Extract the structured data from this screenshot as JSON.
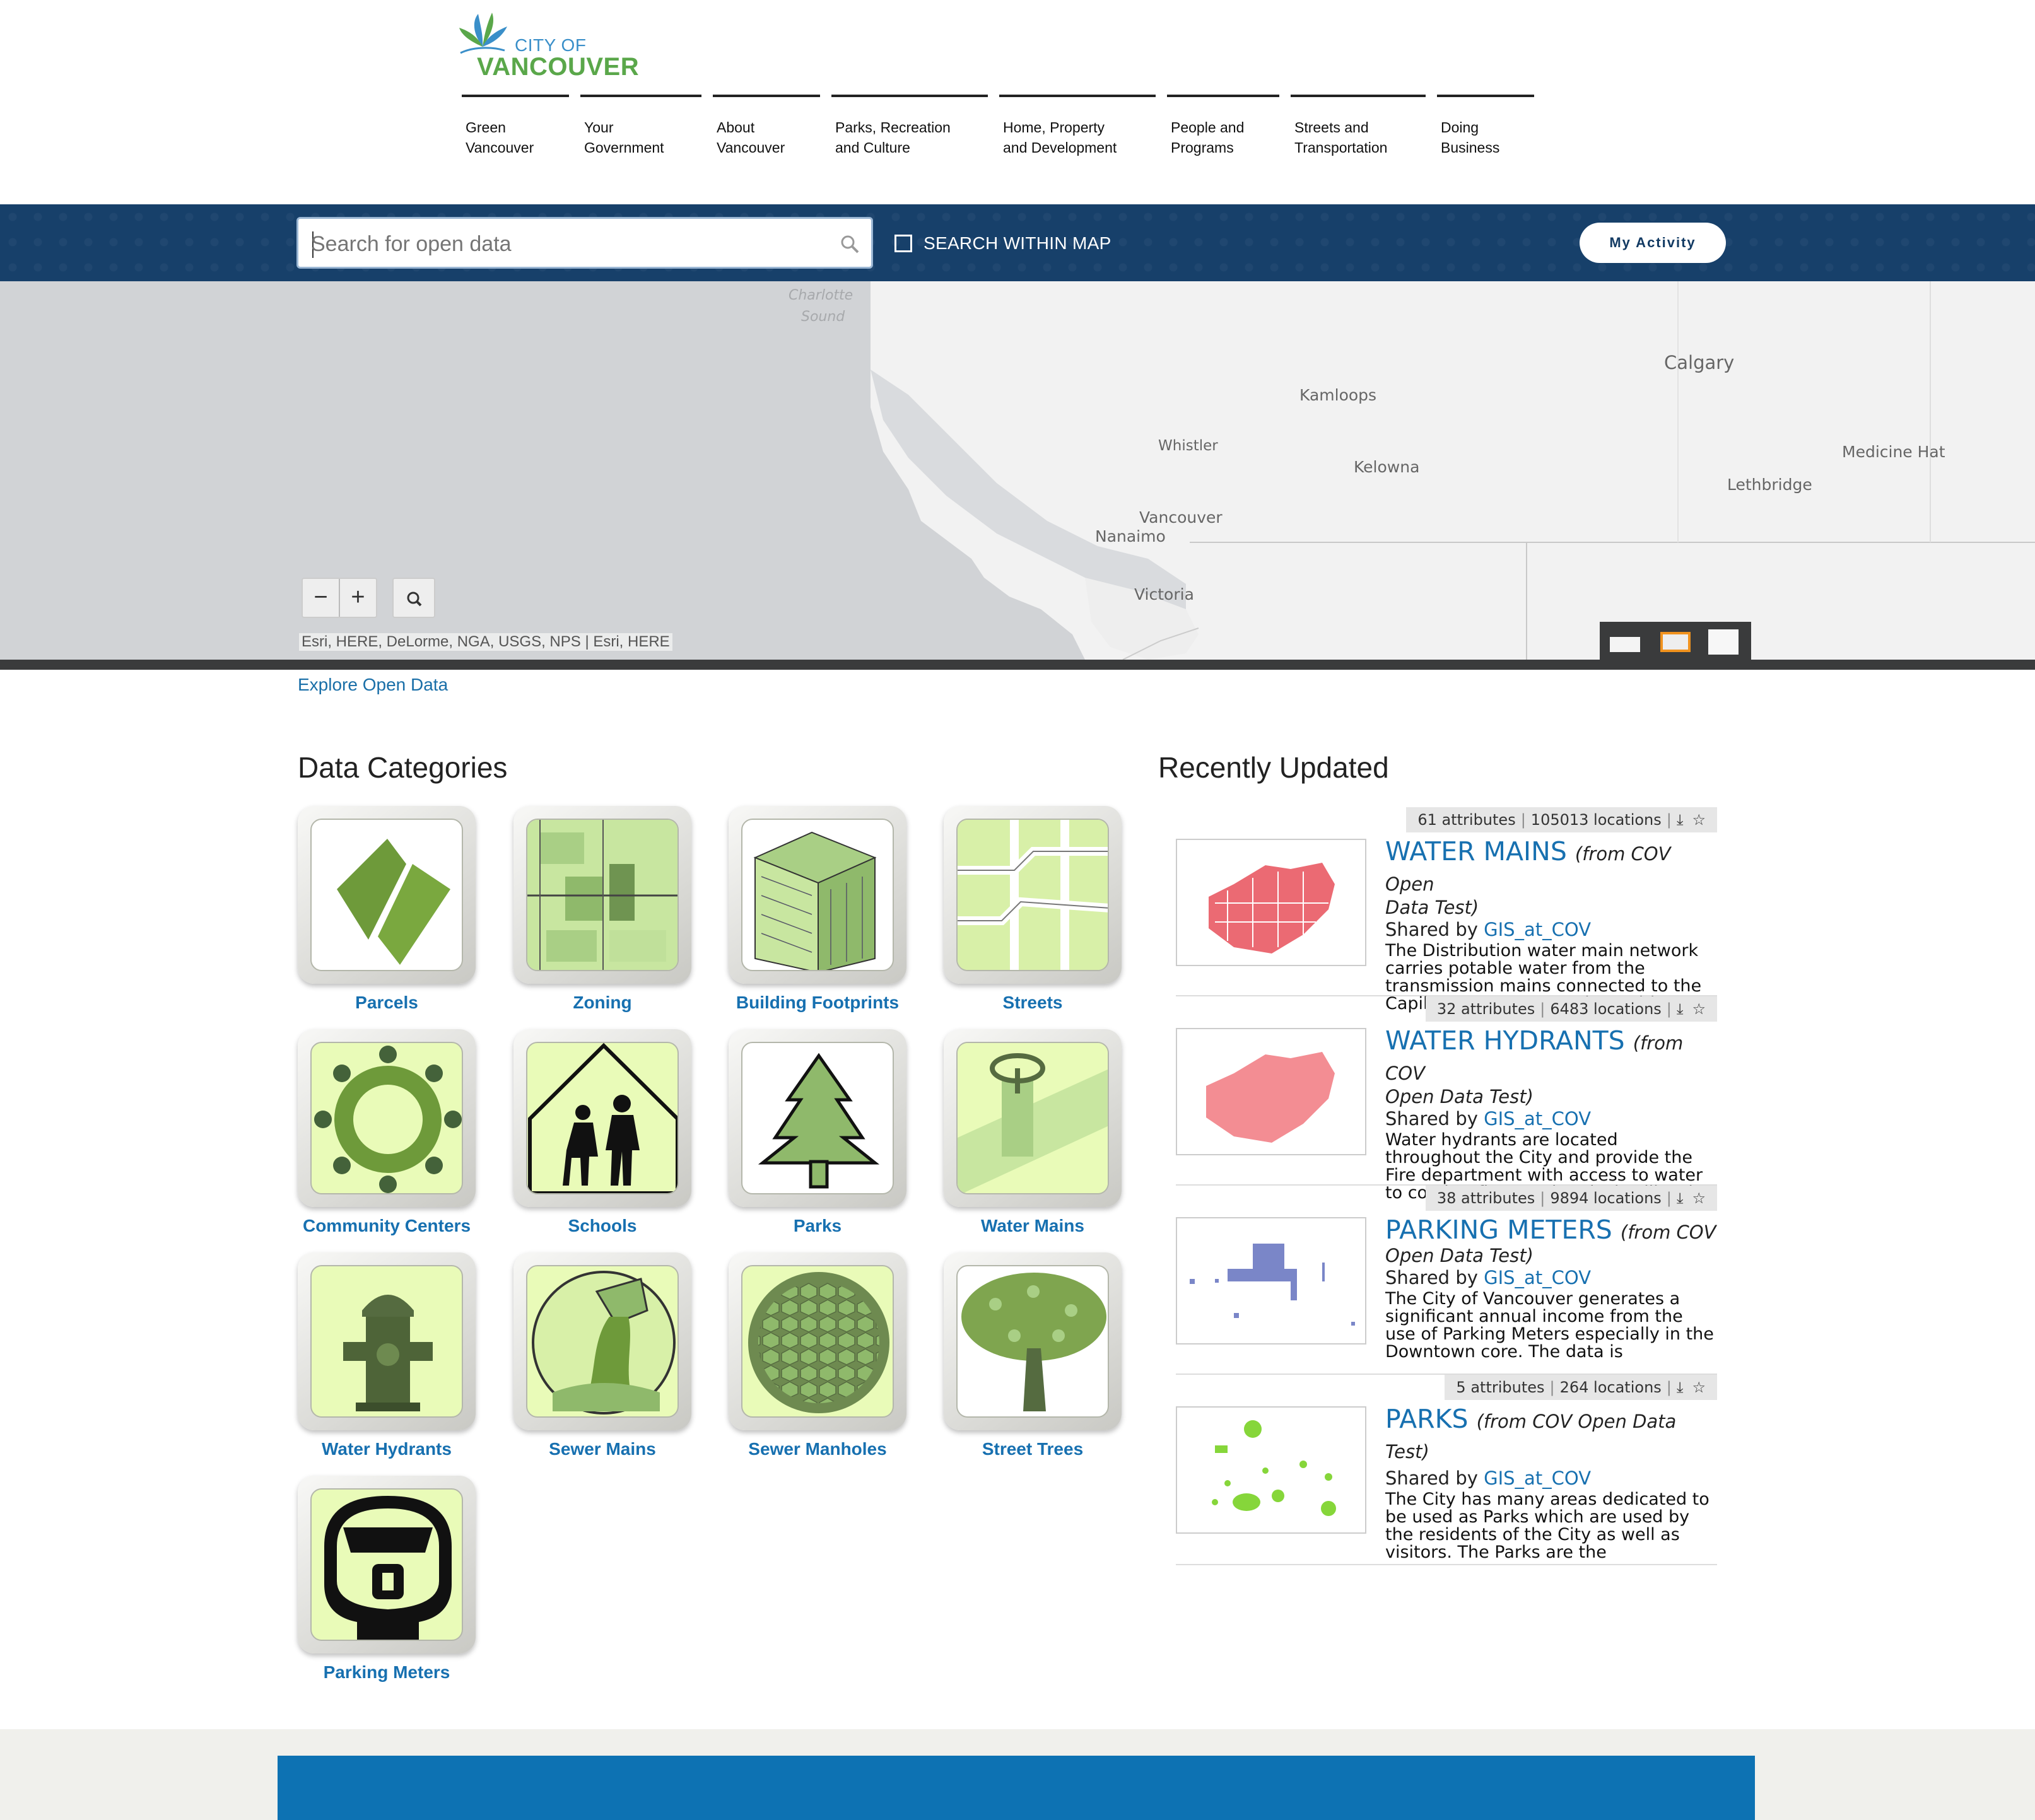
{
  "header": {
    "logo_line1": "CITY OF",
    "logo_line2": "VANCOUVER",
    "nav": [
      {
        "line1": "Green",
        "line2": "Vancouver"
      },
      {
        "line1": "Your",
        "line2": "Government"
      },
      {
        "line1": "About",
        "line2": "Vancouver"
      },
      {
        "line1": "Parks, Recreation",
        "line2": "and Culture"
      },
      {
        "line1": "Home, Property",
        "line2": "and Development"
      },
      {
        "line1": "People and",
        "line2": "Programs"
      },
      {
        "line1": "Streets and",
        "line2": "Transportation"
      },
      {
        "line1": "Doing",
        "line2": "Business"
      }
    ]
  },
  "search": {
    "placeholder": "Search for open data",
    "within_map_label": "SEARCH WITHIN MAP",
    "my_activity_label": "My Activity"
  },
  "map": {
    "places": [
      "Charlotte",
      "Sound",
      "Calgary",
      "Kamloops",
      "Whistler",
      "Kelowna",
      "Medicine Hat",
      "Lethbridge",
      "Vancouver",
      "Nanaimo",
      "Victoria"
    ],
    "zoom_out": "−",
    "zoom_in": "+",
    "attribution": "Esri, HERE, DeLorme, NGA, USGS, NPS |  Esri, HERE"
  },
  "explore_link": "Explore Open Data",
  "categories": {
    "title": "Data Categories",
    "items": [
      "Parcels",
      "Zoning",
      "Building Footprints",
      "Streets",
      "Community Centers",
      "Schools",
      "Parks",
      "Water Mains",
      "Water Hydrants",
      "Sewer Mains",
      "Sewer Manholes",
      "Street Trees",
      "Parking Meters"
    ]
  },
  "recent": {
    "title": "Recently Updated",
    "items": [
      {
        "attributes": "61 attributes",
        "locations": "105013 locations",
        "title": "WATER MAINS",
        "source_a": "(from COV Open",
        "source_b": "Data Test)",
        "shared_label": "Shared by",
        "owner": "GIS_at_COV",
        "description": "The Distribution water main network carries potable water from the transmission mains connected to the Capilano, Seymour, and Coquitlam",
        "thumb_color": "#e8505a"
      },
      {
        "attributes": "32 attributes",
        "locations": "6483 locations",
        "title": "WATER HYDRANTS",
        "source_a": "(from COV",
        "source_b": "Open Data Test)",
        "shared_label": "Shared by",
        "owner": "GIS_at_COV",
        "description": "Water hydrants are located throughout the City and provide the Fire department with access to water to combat fires or chemical spills. The",
        "thumb_color": "#f07078"
      },
      {
        "attributes": "38 attributes",
        "locations": "9894 locations",
        "title": "PARKING METERS",
        "source_a": "(from COV",
        "source_b": "Open Data Test)",
        "shared_label": "Shared by",
        "owner": "GIS_at_COV",
        "description": "The City of Vancouver generates a significant annual income from the use of Parking Meters especially in the Downtown core. The data is",
        "thumb_color": "#7a86c8"
      },
      {
        "attributes": "5 attributes",
        "locations": "264 locations",
        "title": "PARKS",
        "source_a": "(from COV Open Data Test)",
        "source_b": "",
        "shared_label": "Shared by",
        "owner": "GIS_at_COV",
        "description": "The City has many areas dedicated to be used as Parks which are used by the residents of the City as well as visitors. The Parks are the",
        "thumb_color": "#86d63a"
      }
    ]
  },
  "colors": {
    "brand_blue": "#1770b0",
    "band_navy": "#17406a",
    "tile_green": "#e9fbb8",
    "icon_green": "#6e9a3a"
  }
}
